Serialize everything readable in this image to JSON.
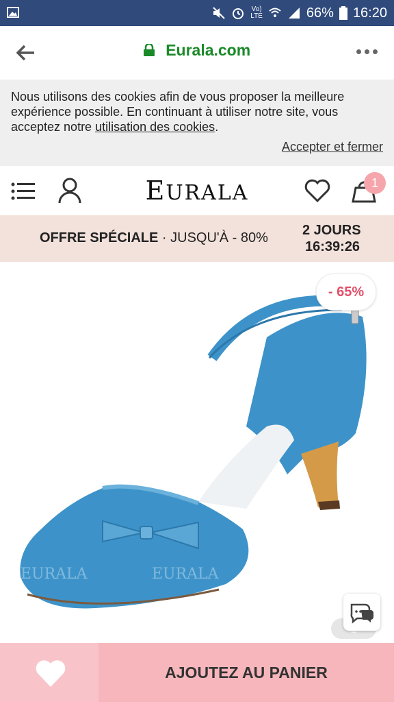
{
  "status_bar": {
    "battery": "66%",
    "time": "16:20",
    "lte_label": "LTE",
    "volte_label": "Vo)"
  },
  "browser": {
    "url": "Eurala.com"
  },
  "cookie_banner": {
    "text_before_link": "Nous utilisons des cookies afin de vous proposer la meilleure expérience possible. En continuant à utiliser notre site, vous acceptez notre ",
    "link_text": "utilisation des cookies",
    "text_after_link": ".",
    "accept_label": "Accepter et fermer"
  },
  "header": {
    "logo_text_first": "E",
    "logo_text_rest": "URALA",
    "cart_count": "1"
  },
  "promo": {
    "offer_bold": "OFFRE SPÉCIALE",
    "offer_rest": " · JUSQU'À - 80%",
    "days": "2 JOURS",
    "time_left": "16:39:26"
  },
  "product": {
    "discount": "- 65%",
    "watermark": "EURALA",
    "image_pager": "1"
  },
  "bottom_bar": {
    "add_to_cart": "AJOUTEZ AU PANIER"
  },
  "colors": {
    "status_bar": "#2f4a7b",
    "url_green": "#1a8a28",
    "promo_bg": "#f3e2db",
    "cart_pink": "#f6b6bb",
    "discount_red": "#e34f6a",
    "shoe_blue": "#3d93c9"
  },
  "icons": [
    "image-icon",
    "mute-icon",
    "alarm-icon",
    "wifi-icon",
    "signal-icon",
    "battery-icon",
    "back-arrow-icon",
    "lock-icon",
    "more-icon",
    "menu-icon",
    "user-icon",
    "heart-icon",
    "bag-icon",
    "chat-icon"
  ]
}
